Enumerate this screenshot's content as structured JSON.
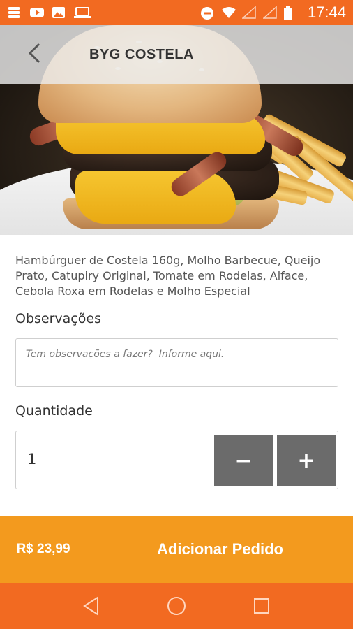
{
  "status_bar": {
    "time": "17:44",
    "left_icons": [
      "storage-icon",
      "youtube-icon",
      "image-icon",
      "laptop-icon"
    ],
    "right_icons": [
      "do-not-disturb-icon",
      "wifi-icon",
      "signal-icon",
      "signal-icon",
      "battery-icon"
    ]
  },
  "header": {
    "title": "BYG COSTELA",
    "back_icon": "chevron-left-icon"
  },
  "product": {
    "description": "Hambúrguer de Costela 160g, Molho Barbecue, Queijo Prato, Catupiry Original, Tomate em Rodelas, Alface, Cebola Roxa em Rodelas e Molho Especial"
  },
  "observations": {
    "label": "Observações",
    "placeholder": "Tem observações a fazer?  Informe aqui.",
    "value": ""
  },
  "quantity": {
    "label": "Quantidade",
    "value": "1",
    "minus_label": "−",
    "plus_label": "+"
  },
  "order": {
    "price": "R$ 23,99",
    "add_label": "Adicionar Pedido"
  },
  "nav": {
    "buttons": [
      "back-triangle-icon",
      "home-circle-icon",
      "recents-square-icon"
    ]
  },
  "colors": {
    "status_bar": "#f26a21",
    "order_bar": "#f39a1e",
    "qty_button": "#6b6b6b"
  }
}
